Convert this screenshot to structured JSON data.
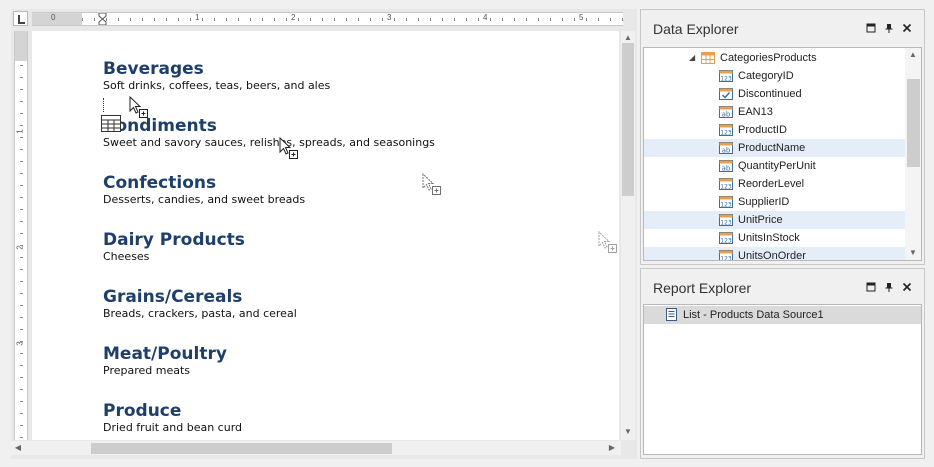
{
  "report": {
    "categories": [
      {
        "name": "Beverages",
        "description": "Soft drinks, coffees, teas, beers, and ales"
      },
      {
        "name": "Condiments",
        "description": "Sweet and savory sauces, relishes, spreads, and seasonings"
      },
      {
        "name": "Confections",
        "description": "Desserts, candies, and sweet breads"
      },
      {
        "name": "Dairy Products",
        "description": "Cheeses"
      },
      {
        "name": "Grains/Cereals",
        "description": "Breads, crackers, pasta, and cereal"
      },
      {
        "name": "Meat/Poultry",
        "description": "Prepared meats"
      },
      {
        "name": "Produce",
        "description": "Dried fruit and bean curd"
      }
    ]
  },
  "h_ruler_numbers": [
    "0",
    "1",
    "2",
    "3",
    "4",
    "5"
  ],
  "v_ruler_numbers": [
    "1",
    "2",
    "3"
  ],
  "data_explorer": {
    "title": "Data Explorer",
    "root": {
      "label": "CategoriesProducts",
      "icon": "table-icon"
    },
    "fields": [
      {
        "label": "CategoryID",
        "icon": "numeric-field-icon"
      },
      {
        "label": "Discontinued",
        "icon": "boolean-field-icon"
      },
      {
        "label": "EAN13",
        "icon": "string-field-icon"
      },
      {
        "label": "ProductID",
        "icon": "numeric-field-icon"
      },
      {
        "label": "ProductName",
        "icon": "string-field-icon",
        "selected": true
      },
      {
        "label": "QuantityPerUnit",
        "icon": "string-field-icon"
      },
      {
        "label": "ReorderLevel",
        "icon": "numeric-field-icon"
      },
      {
        "label": "SupplierID",
        "icon": "numeric-field-icon"
      },
      {
        "label": "UnitPrice",
        "icon": "numeric-field-icon",
        "selected": true
      },
      {
        "label": "UnitsInStock",
        "icon": "numeric-field-icon"
      },
      {
        "label": "UnitsOnOrder",
        "icon": "numeric-field-icon",
        "selected": true
      }
    ]
  },
  "report_explorer": {
    "title": "Report Explorer",
    "items": [
      {
        "label": "List - Products Data Source1",
        "icon": "list-icon"
      }
    ]
  },
  "colors": {
    "category_name": "#1f3f6b",
    "selection": "#e5eef8",
    "icon_orange": "#e8a04a",
    "icon_blue": "#3a6ea5"
  }
}
